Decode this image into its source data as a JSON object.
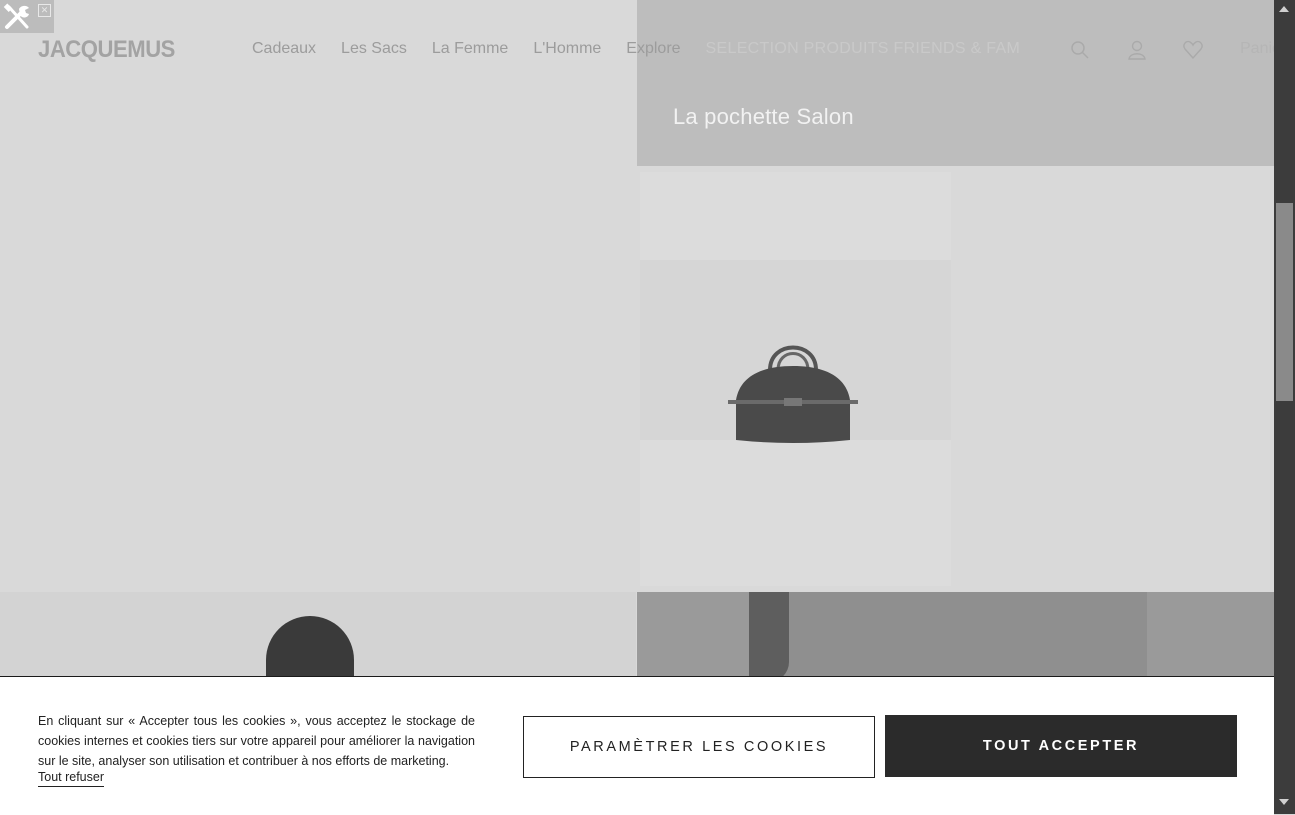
{
  "header": {
    "logo": "JACQUEMUS",
    "nav": [
      {
        "label": "Cadeaux"
      },
      {
        "label": "Les Sacs"
      },
      {
        "label": "La Femme"
      },
      {
        "label": "L'Homme"
      },
      {
        "label": "Explore"
      },
      {
        "label": "SELECTION PRODUITS FRIENDS & FAM"
      }
    ],
    "cart_label": "Panier",
    "icons": [
      "search-icon",
      "account-icon",
      "heart-icon"
    ]
  },
  "hero": {
    "title": "La pochette Salon"
  },
  "product": {
    "image_icon": "handbag-icon"
  },
  "cookie_banner": {
    "text": "En cliquant sur « Accepter tous les cookies », vous acceptez le stockage de cookies internes et cookies tiers sur votre appareil pour améliorer la navigation sur le site, analyser son utilisation et contribuer à nos efforts de marketing.",
    "refuse_label": "Tout refuser",
    "settings_label": "PARAMÈTRER LES COOKIES",
    "accept_label": "TOUT ACCEPTER"
  },
  "colors": {
    "overlay": "#d9d9d9",
    "accept_button": "#2b2b2b",
    "banner_background": "#ffffff"
  }
}
